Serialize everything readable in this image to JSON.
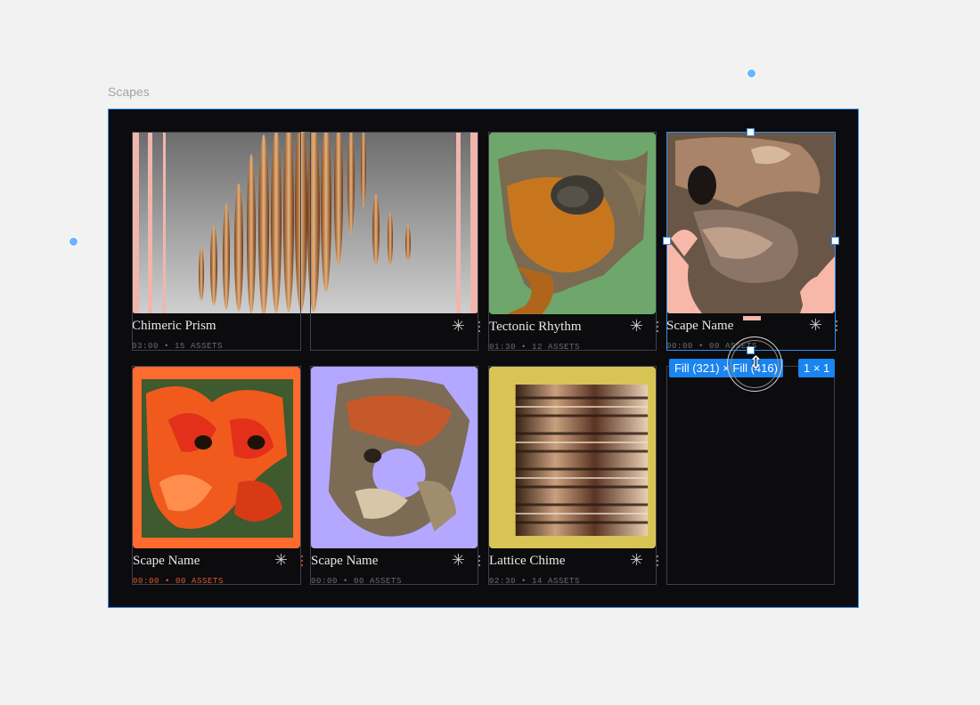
{
  "frame": {
    "label": "Scapes"
  },
  "cards": [
    {
      "title": "Chimeric Prism",
      "meta": "03:00 • 15 ASSETS",
      "color": "#f2b5ac"
    },
    {
      "title": "",
      "meta": "",
      "color": "#f2b5ac"
    },
    {
      "title": "Tectonic Rhythm",
      "meta": "01:30 • 12 ASSETS",
      "color": "#6fa66b"
    },
    {
      "title": "Scape Name",
      "meta": "00:00 • 00 ASSETS",
      "color": "#f7b8aa"
    },
    {
      "title": "Scape Name",
      "meta": "00:00 • 00 ASSETS",
      "color": "#ff6a2e"
    },
    {
      "title": "Scape Name",
      "meta": "00:00 • 00 ASSETS",
      "color": "#b3a7ff"
    },
    {
      "title": "Lattice Chime",
      "meta": "02:30 • 14 ASSETS",
      "color": "#d8c455"
    }
  ],
  "selection": {
    "size_label": "Fill (321) × Fill (416)",
    "grid_label": "1 × 1"
  },
  "icons": {
    "star": "✳",
    "resize": "⇕"
  }
}
